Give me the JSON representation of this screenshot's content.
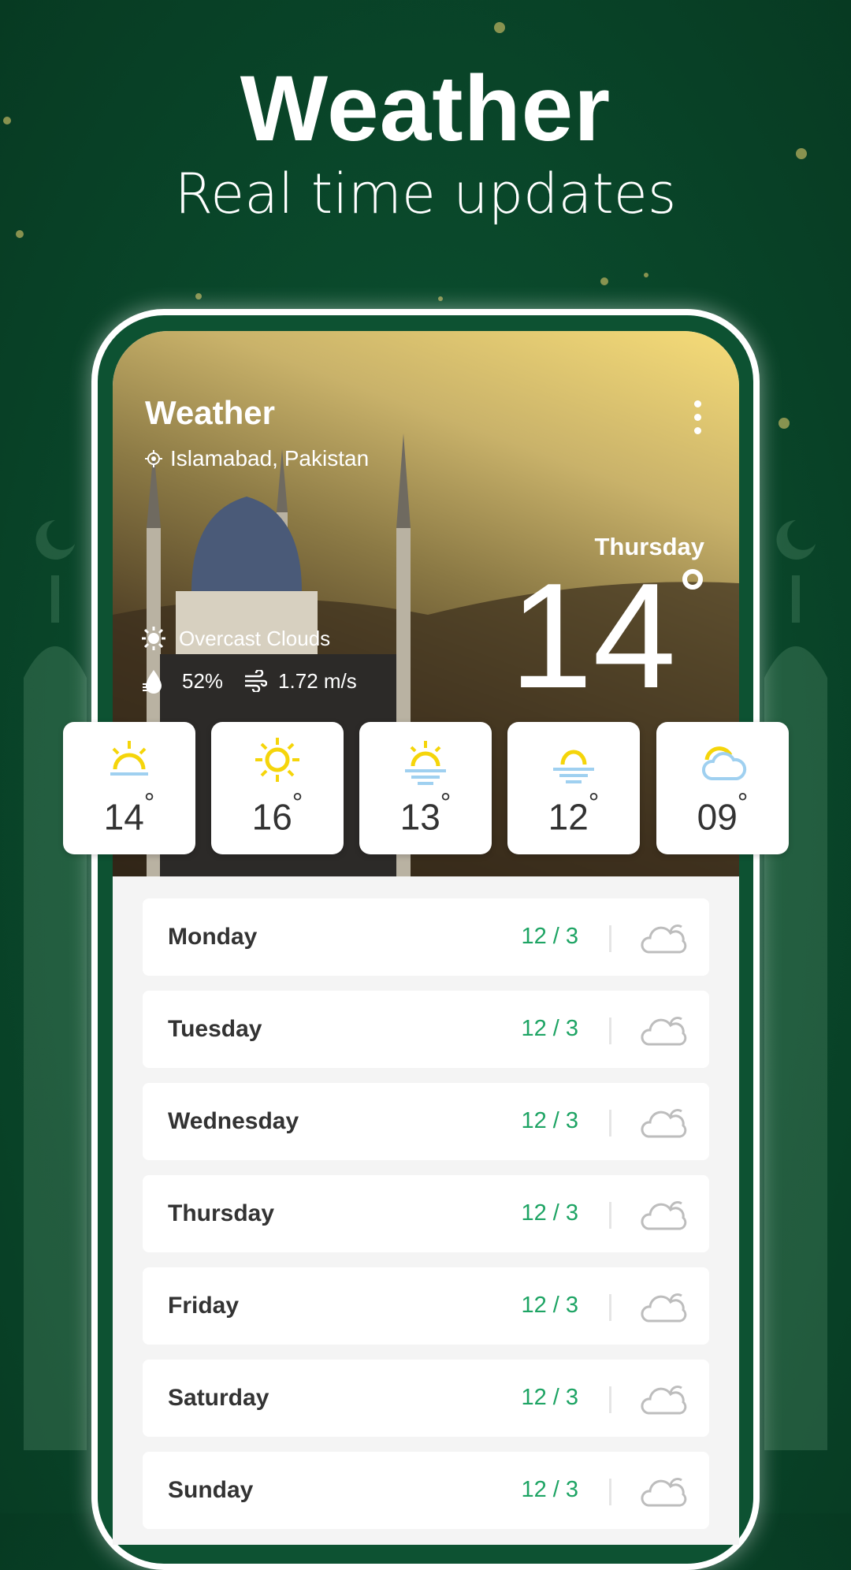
{
  "promo": {
    "title": "Weather",
    "subtitle": "Real time updates"
  },
  "header": {
    "title": "Weather",
    "location": "Islamabad, Pakistan",
    "day": "Thursday",
    "temperature": "14",
    "condition": "Overcast Clouds",
    "humidity": "52%",
    "wind": "1.72 m/s"
  },
  "hourly": [
    {
      "temp": "14",
      "icon": "sunrise-icon"
    },
    {
      "temp": "16",
      "icon": "sun-icon"
    },
    {
      "temp": "13",
      "icon": "sun-haze-icon"
    },
    {
      "temp": "12",
      "icon": "sunset-haze-icon"
    },
    {
      "temp": "09",
      "icon": "partly-cloudy-icon"
    }
  ],
  "daily": [
    {
      "day": "Monday",
      "range": "12 / 3",
      "icon": "cloud-icon"
    },
    {
      "day": "Tuesday",
      "range": "12 / 3",
      "icon": "cloud-icon"
    },
    {
      "day": "Wednesday",
      "range": "12 / 3",
      "icon": "cloud-icon"
    },
    {
      "day": "Thursday",
      "range": "12 / 3",
      "icon": "cloud-icon"
    },
    {
      "day": "Friday",
      "range": "12 / 3",
      "icon": "cloud-icon"
    },
    {
      "day": "Saturday",
      "range": "12 / 3",
      "icon": "cloud-icon"
    },
    {
      "day": "Sunday",
      "range": "12 / 3",
      "icon": "cloud-icon"
    }
  ],
  "colors": {
    "background": "#0a4a2c",
    "accent": "#1ea464",
    "sun": "#f5d50a",
    "haze": "#9fd0f0"
  }
}
